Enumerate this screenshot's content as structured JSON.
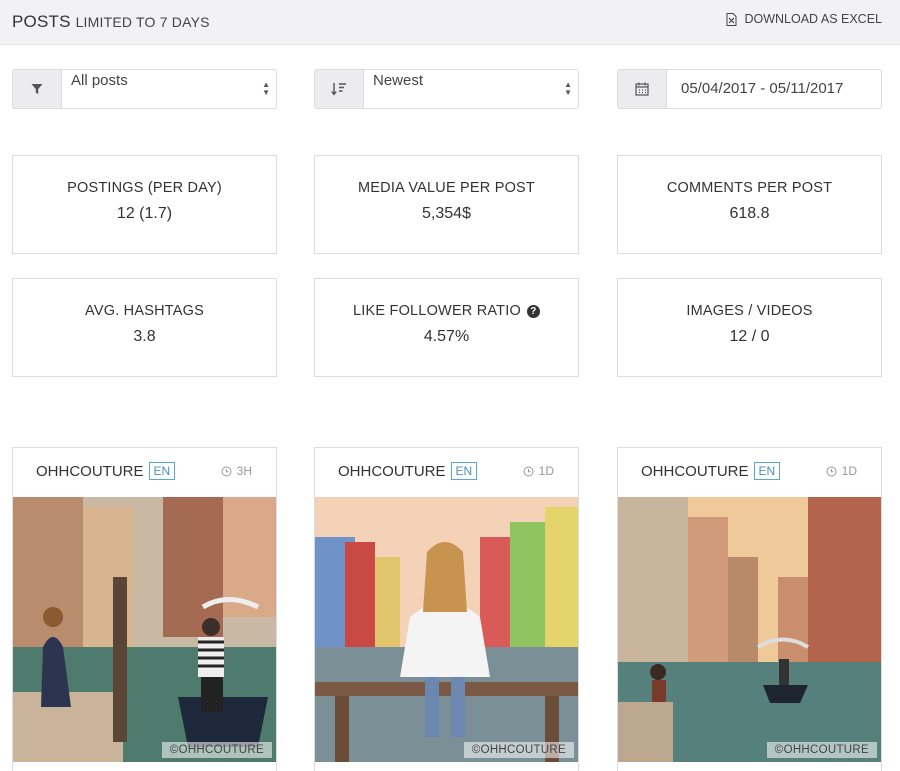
{
  "header": {
    "title": "POSTS",
    "subtitle": "LIMITED TO 7 DAYS",
    "download_label": "DOWNLOAD AS EXCEL"
  },
  "filters": {
    "type": {
      "icon": "filter-icon",
      "value": "All posts"
    },
    "sort": {
      "icon": "sort-icon",
      "value": "Newest"
    },
    "date": {
      "icon": "calendar-icon",
      "value": "05/04/2017 - 05/11/2017"
    }
  },
  "stats": [
    {
      "label": "POSTINGS (PER DAY)",
      "value": "12 (1.7)"
    },
    {
      "label": "MEDIA VALUE PER POST",
      "value": "5,354$"
    },
    {
      "label": "COMMENTS PER POST",
      "value": "618.8"
    },
    {
      "label": "AVG. HASHTAGS",
      "value": "3.8"
    },
    {
      "label": "LIKE FOLLOWER RATIO",
      "value": "4.57%",
      "help": "?"
    },
    {
      "label": "IMAGES / VIDEOS",
      "value": "12 / 0"
    }
  ],
  "posts": [
    {
      "user": "OHHCOUTURE",
      "lang": "EN",
      "age": "3H",
      "credit": "©OHHCOUTURE"
    },
    {
      "user": "OHHCOUTURE",
      "lang": "EN",
      "age": "1D",
      "credit": "©OHHCOUTURE"
    },
    {
      "user": "OHHCOUTURE",
      "lang": "EN",
      "age": "1D",
      "credit": "©OHHCOUTURE"
    }
  ],
  "colors": {
    "accent_blue": "#4a8fc0",
    "border": "#dcdce0",
    "topbar": "#f2f2f4"
  }
}
